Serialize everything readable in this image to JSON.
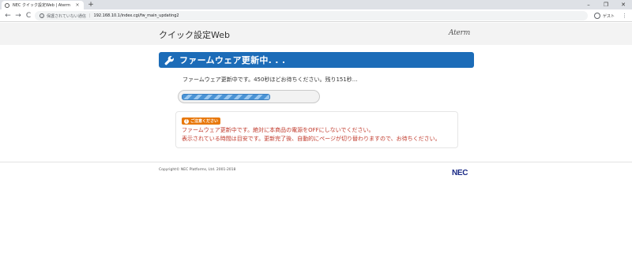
{
  "browser": {
    "tab_title": "NEC クイック設定Web | Aterm",
    "tab_close": "×",
    "new_tab": "+",
    "window_controls": {
      "minimize": "–",
      "restore": "❐",
      "close": "✕"
    },
    "nav": {
      "back": "←",
      "forward": "→",
      "reload": "C"
    },
    "security_label": "保護されていない通信",
    "url": "192.168.10.1/index.cgi/fw_main_updating2",
    "profile_label": "ゲスト",
    "menu": "⋮"
  },
  "header": {
    "title": "クイック設定Web",
    "brand": "Aterm"
  },
  "section": {
    "title": "ファームウェア更新中. . .",
    "icon": "wrench-icon"
  },
  "status": {
    "message": "ファームウェア更新中です。450秒ほどお待ちください。残り151秒...",
    "progress_fraction": 0.66
  },
  "notice": {
    "badge": "ご注意ください",
    "line1": "ファームウェア更新中です。絶対に本商品の電源をOFFにしないでください。",
    "line2": "表示されている時間は目安です。更新完了後、自動的にページが切り替わりますので、お待ちください。"
  },
  "footer": {
    "copyright": "Copyright© NEC Platforms, Ltd. 2001-2018",
    "brand": "NEC"
  },
  "colors": {
    "section_bar": "#1c6cb8",
    "notice_text": "#c0392b",
    "badge": "#e8780b",
    "nec_blue": "#1a2a86"
  }
}
